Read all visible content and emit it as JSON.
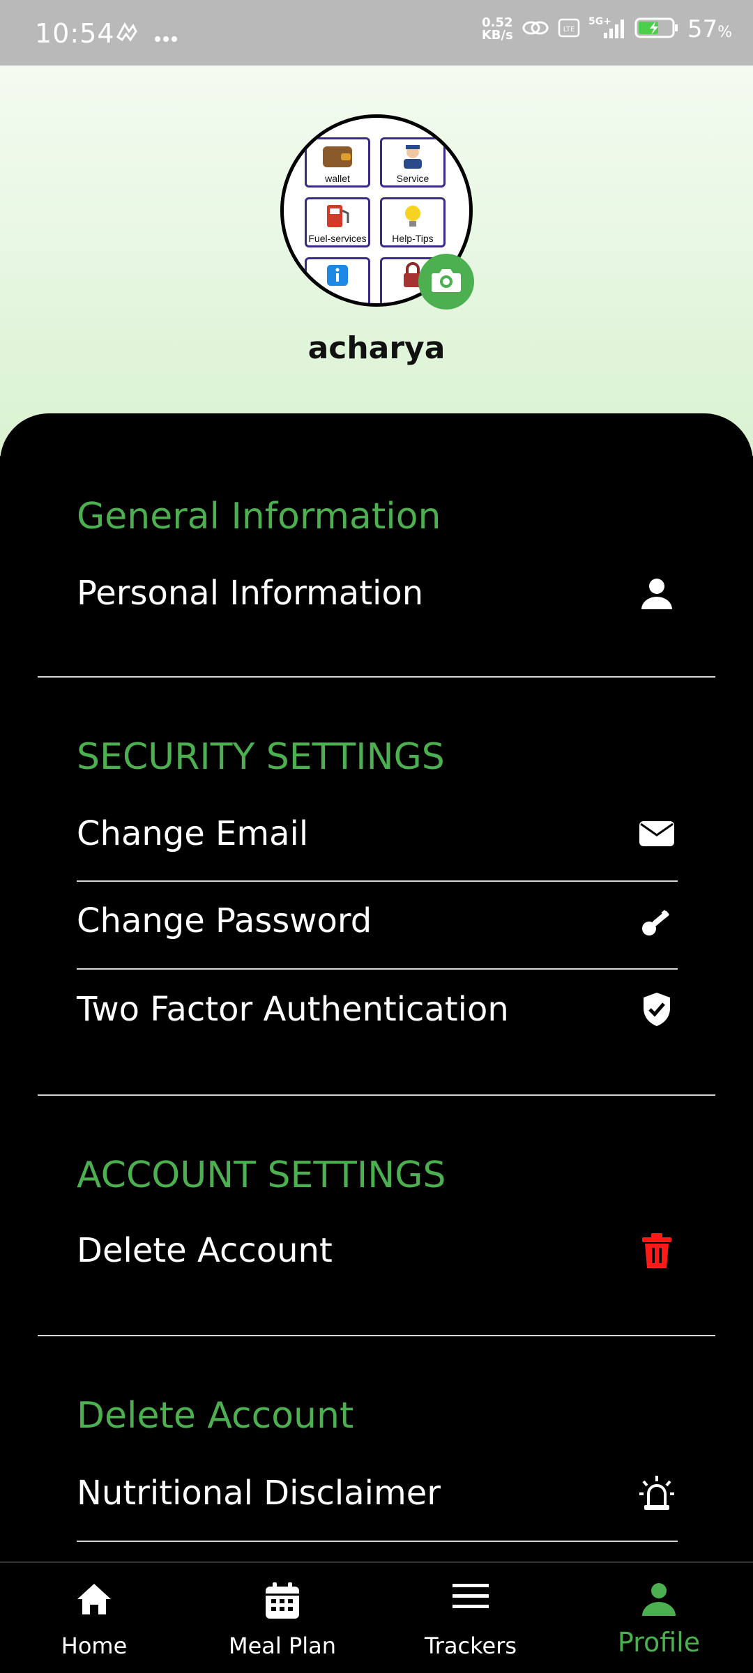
{
  "status_bar": {
    "time": "10:54",
    "speed_value": "0.52",
    "speed_unit": "KB/s",
    "network": "5G+",
    "battery": "57",
    "battery_unit": "%"
  },
  "profile": {
    "username": "acharya",
    "avatar_tiles": [
      "wallet",
      "Service",
      "Fuel-services",
      "Help-Tips"
    ]
  },
  "sections": {
    "general": {
      "title": "General Information",
      "items": [
        {
          "label": "Personal Information",
          "icon": "user-icon"
        }
      ]
    },
    "security": {
      "title": "SECURITY SETTINGS",
      "items": [
        {
          "label": "Change Email",
          "icon": "envelope-icon"
        },
        {
          "label": "Change Password",
          "icon": "key-icon"
        },
        {
          "label": "Two Factor Authentication",
          "icon": "shield-check-icon"
        }
      ]
    },
    "account": {
      "title": "ACCOUNT SETTINGS",
      "items": [
        {
          "label": "Delete Account",
          "icon": "trash-icon"
        }
      ]
    },
    "other": {
      "title": "Delete Account",
      "items": [
        {
          "label": "Nutritional Disclaimer",
          "icon": "alarm-icon"
        }
      ]
    }
  },
  "nav": {
    "items": [
      {
        "label": "Home",
        "icon": "home-icon"
      },
      {
        "label": "Meal Plan",
        "icon": "calendar-icon"
      },
      {
        "label": "Trackers",
        "icon": "menu-icon"
      },
      {
        "label": "Profile",
        "icon": "person-icon"
      }
    ],
    "active": "Profile"
  },
  "colors": {
    "accent": "#4caf50",
    "danger": "#ff1a1a",
    "background": "#000000",
    "header_gradient_top": "#f4fbf1",
    "header_gradient_bottom": "#d9f2d1"
  }
}
